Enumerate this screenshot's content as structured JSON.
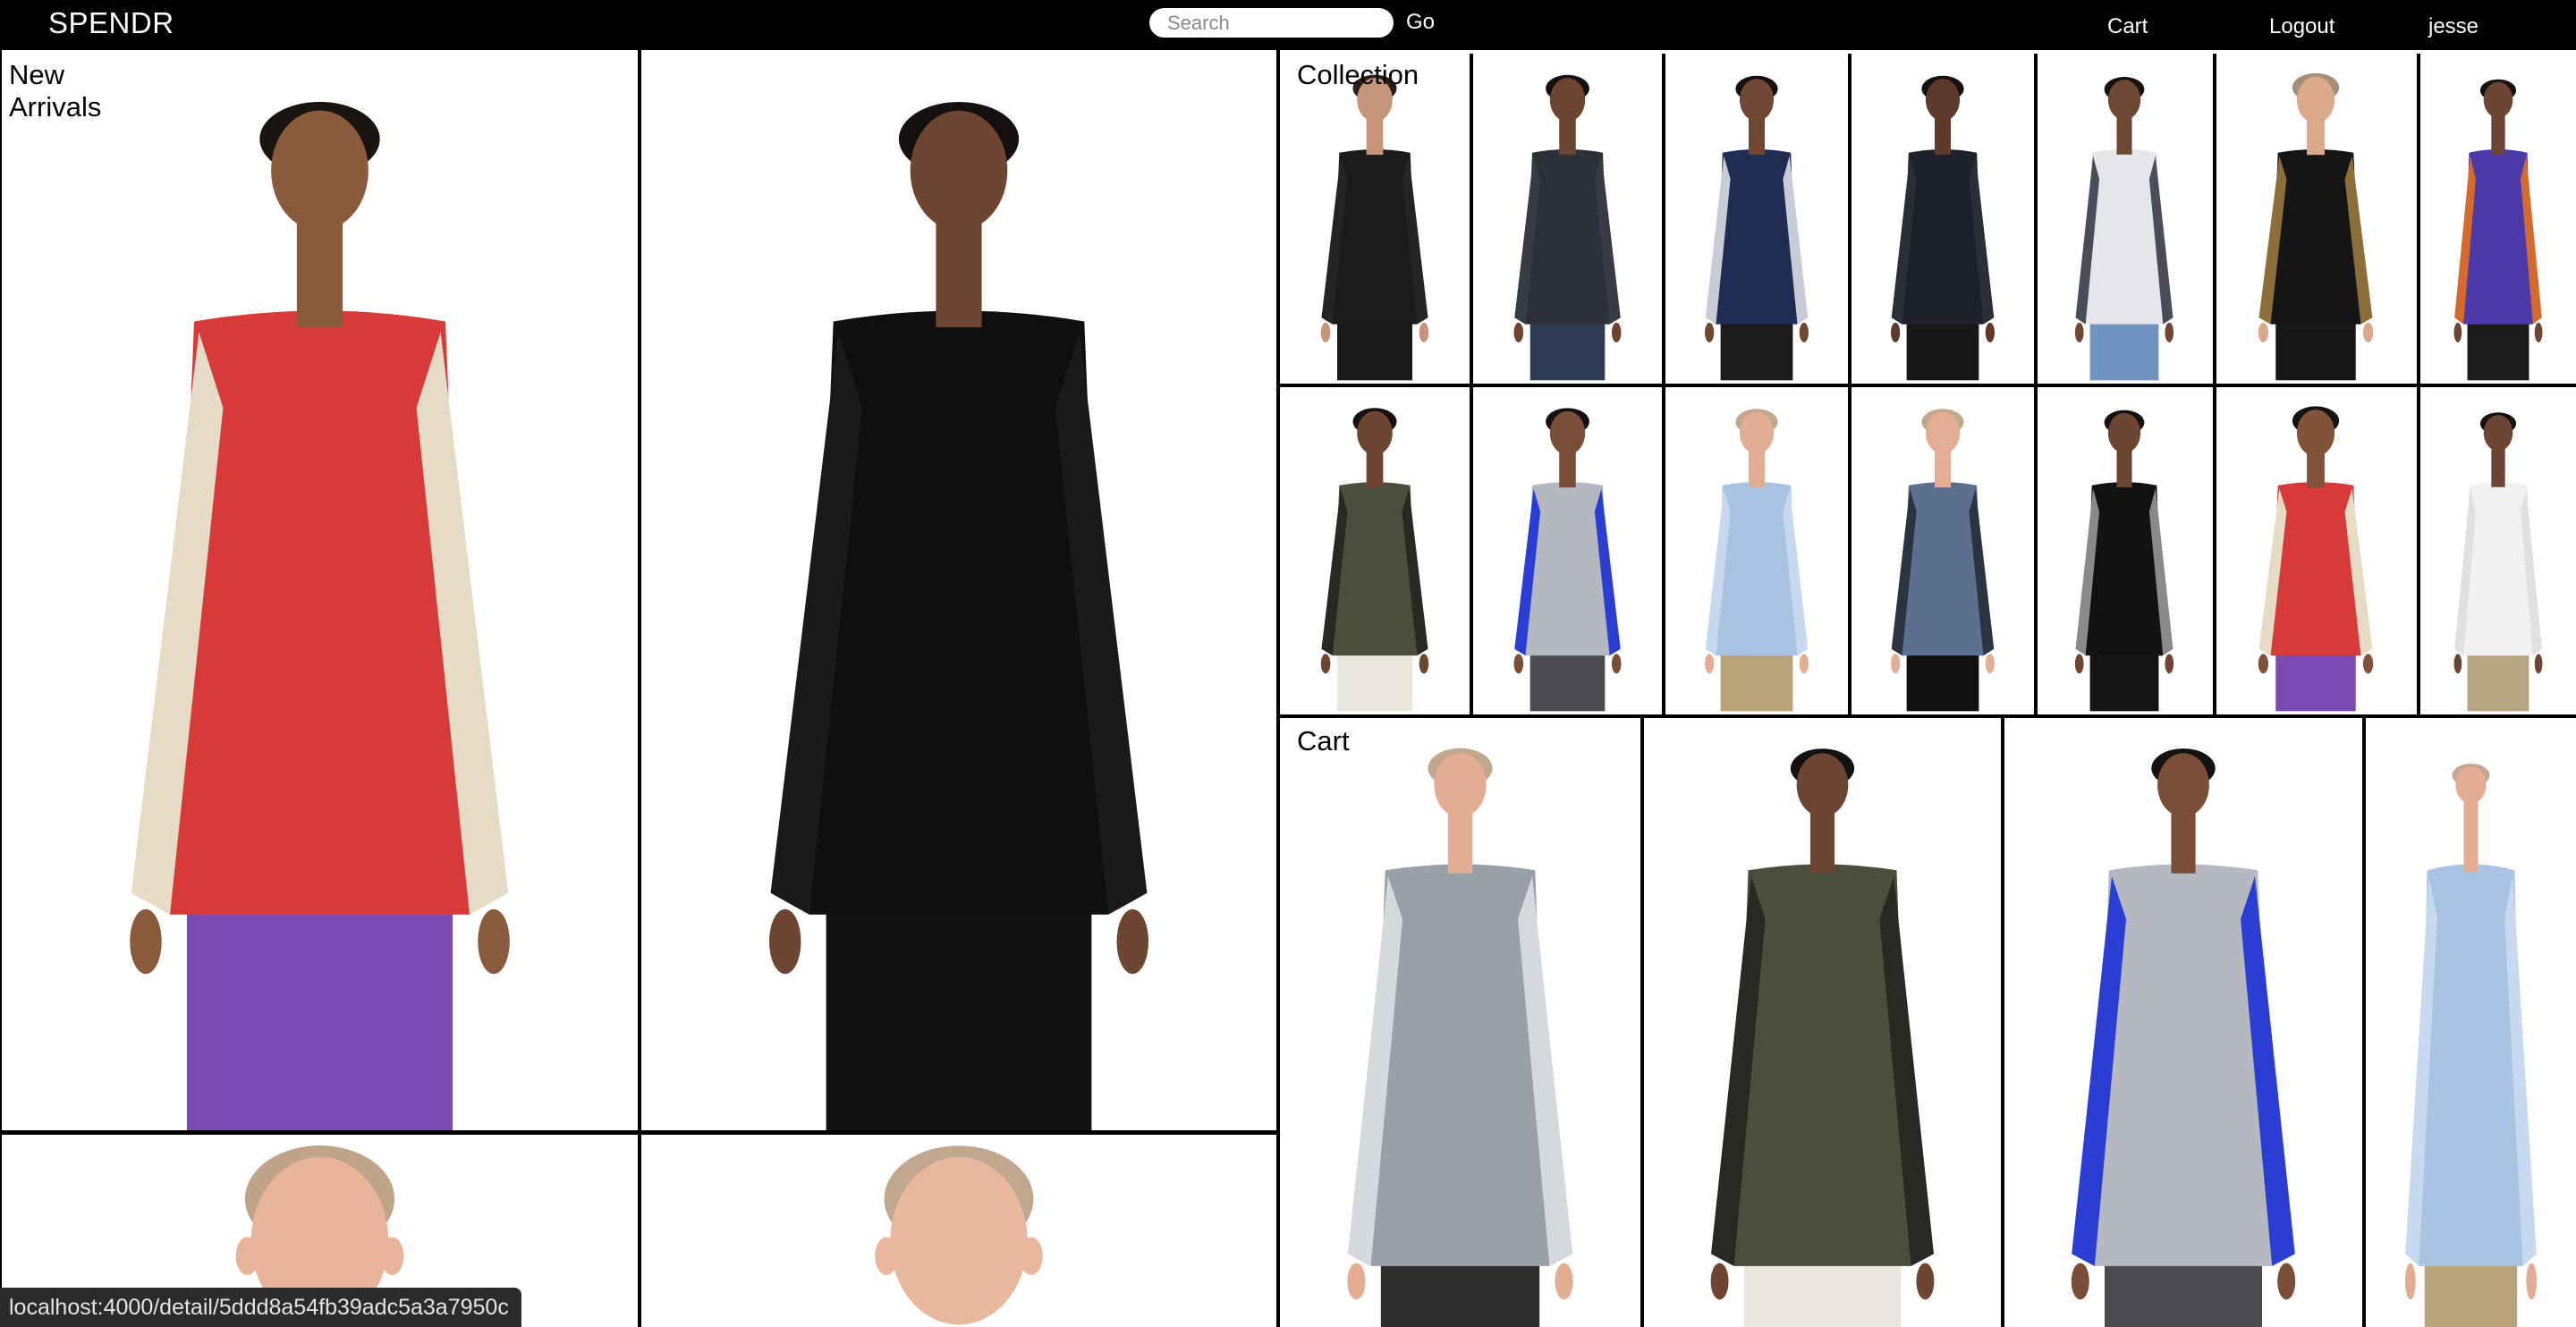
{
  "brand": "SPENDR",
  "search": {
    "placeholder": "Search",
    "value": "",
    "button_label": "Go"
  },
  "nav": {
    "cart": "Cart",
    "logout": "Logout",
    "user": "jesse"
  },
  "sections": {
    "new_arrivals": {
      "title_line1": "New",
      "title_line2": "Arrivals"
    },
    "collection": {
      "title": "Collection"
    },
    "cart": {
      "title": "Cart"
    }
  },
  "status_url": "localhost:4000/detail/5ddd8a54fb39adc5a3a7950c",
  "icons": {
    "product_image": "model-photo"
  },
  "colors": {
    "nav_bg": "#000000",
    "nav_text": "#ffffff",
    "page_bg": "#ffffff",
    "status_bg": "#2b2b2b"
  },
  "new_arrivals": [
    {
      "top": "red-beige-black windbreaker",
      "bottom": "purple pants"
    },
    {
      "top": "black v-neck sweater",
      "bottom": "black skirt"
    },
    {
      "top": "shaved head",
      "bottom": ""
    },
    {
      "top": "shaved head",
      "bottom": ""
    }
  ],
  "collection": [
    {
      "top": "black puffer"
    },
    {
      "top": "charcoal puffer"
    },
    {
      "top": "navy parka"
    },
    {
      "top": "black parka"
    },
    {
      "top": "grey floral shirt"
    },
    {
      "top": "black puffer coat"
    },
    {
      "top": "purple printed shirt"
    },
    {
      "top": "olive puffer"
    },
    {
      "top": "grey-blue puffer"
    },
    {
      "top": "light blue shirt"
    },
    {
      "top": "blue graphic sweater"
    },
    {
      "top": "black v-neck sweater"
    },
    {
      "top": "red-beige windbreaker"
    },
    {
      "top": "white hoodie"
    }
  ],
  "cart": [
    {
      "top": "silver metallic jacket"
    },
    {
      "top": "olive puffer"
    },
    {
      "top": "grey-blue puffer"
    },
    {
      "top": "light blue shirt"
    }
  ]
}
